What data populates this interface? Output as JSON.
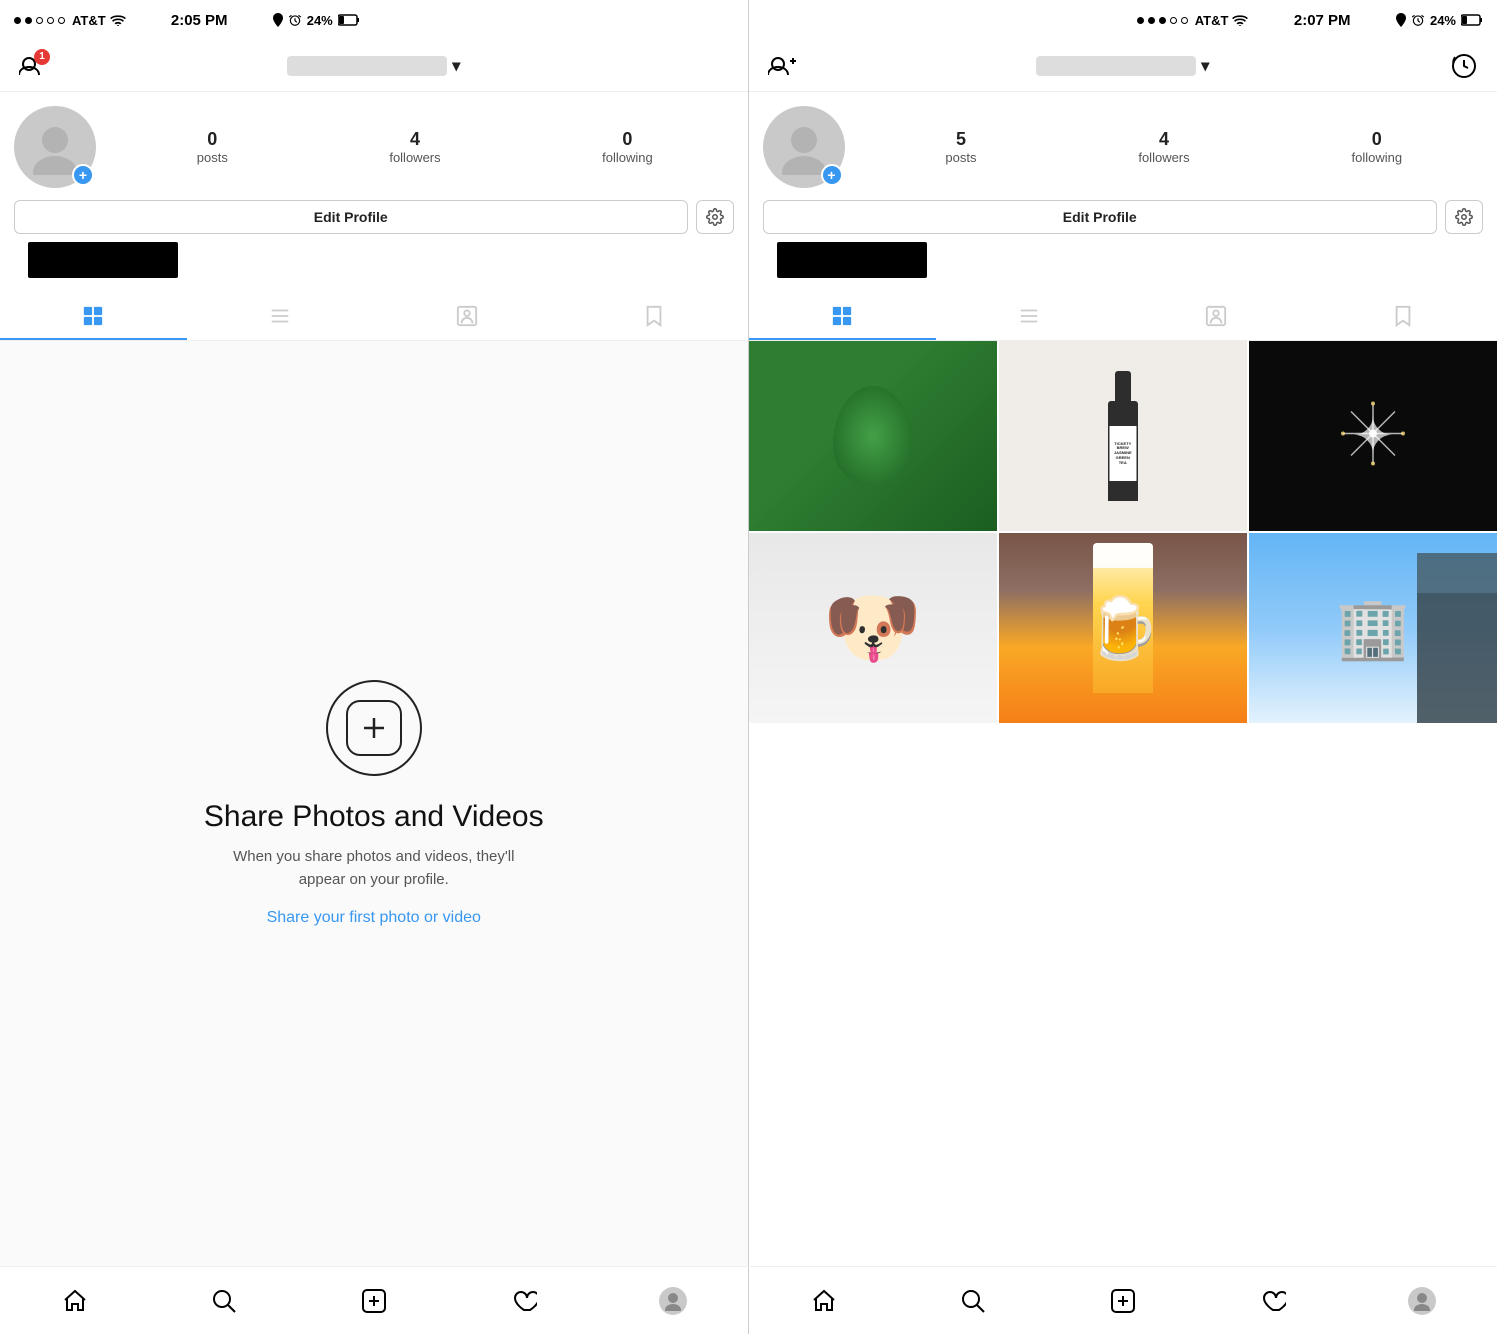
{
  "left_phone": {
    "status": {
      "carrier": "AT&T",
      "time": "2:05 PM",
      "battery": "24%"
    },
    "nav": {
      "add_button_label": "+",
      "notification_count": "1",
      "username_placeholder": "username",
      "dropdown_label": "▾"
    },
    "profile": {
      "posts_count": "0",
      "posts_label": "posts",
      "followers_count": "4",
      "followers_label": "followers",
      "following_count": "0",
      "following_label": "following",
      "edit_button_label": "Edit Profile"
    },
    "tabs": {
      "grid": "Grid",
      "list": "List",
      "person": "Tagged",
      "bookmark": "Saved"
    },
    "empty_state": {
      "icon_label": "add-photo-icon",
      "title": "Share Photos and Videos",
      "description": "When you share photos and videos, they'll appear on your profile.",
      "link": "Share your first photo or video"
    }
  },
  "right_phone": {
    "status": {
      "carrier": "AT&T",
      "time": "2:07 PM",
      "battery": "24%"
    },
    "nav": {
      "add_button_label": "+",
      "username_placeholder": "username",
      "dropdown_label": "▾",
      "history_label": "history"
    },
    "profile": {
      "posts_count": "5",
      "posts_label": "posts",
      "followers_count": "4",
      "followers_label": "followers",
      "following_count": "0",
      "following_label": "following",
      "edit_button_label": "Edit Profile"
    },
    "tabs": {
      "grid": "Grid",
      "list": "List",
      "person": "Tagged",
      "bookmark": "Saved"
    },
    "photos": [
      {
        "id": "egg",
        "alt": "Green dyed egg",
        "class": "photo-egg"
      },
      {
        "id": "bottle",
        "alt": "Ticketybrew bottle",
        "class": "photo-bottle"
      },
      {
        "id": "fireworks",
        "alt": "Fireworks",
        "class": "photo-fireworks"
      },
      {
        "id": "dog",
        "alt": "White fluffy dog",
        "class": "photo-dog"
      },
      {
        "id": "beer",
        "alt": "Beer glass",
        "class": "photo-beer"
      },
      {
        "id": "building",
        "alt": "Building with sky",
        "class": "photo-building"
      }
    ]
  },
  "bottom_nav": {
    "items": [
      "home",
      "search",
      "add",
      "heart",
      "profile"
    ]
  }
}
